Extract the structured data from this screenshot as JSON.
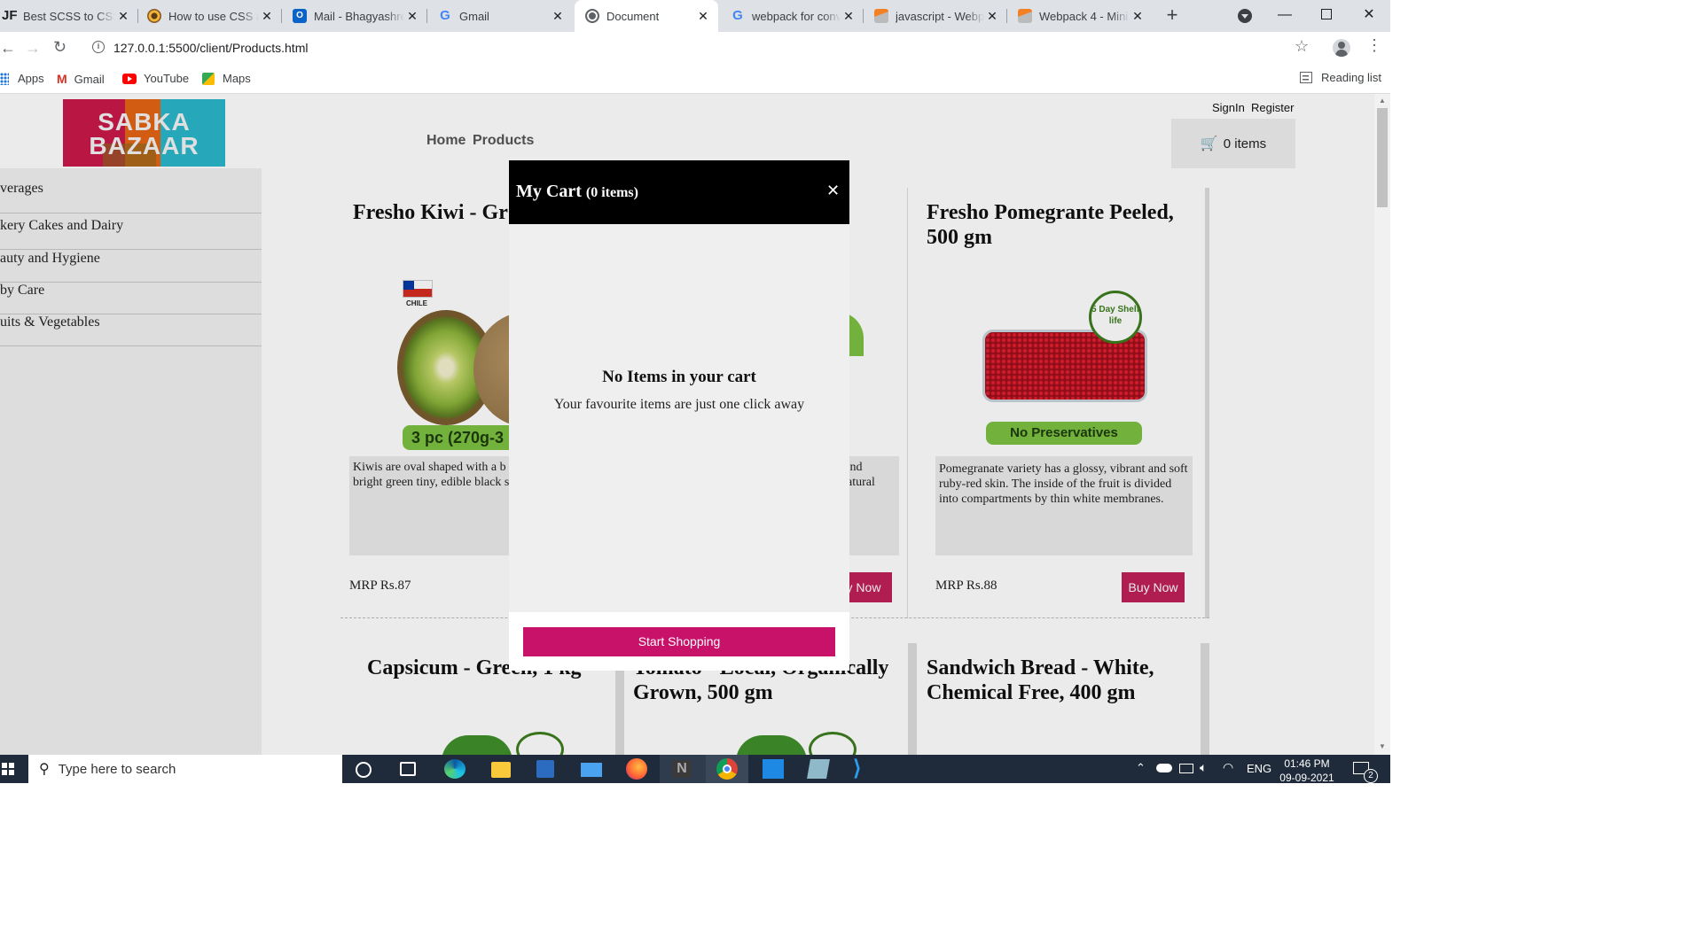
{
  "browser": {
    "tabs": [
      {
        "title": "Best SCSS to CSS",
        "favicon": "jf-icon",
        "active": false
      },
      {
        "title": "How to use CSS a",
        "favicon": "codegrepper-icon",
        "active": false
      },
      {
        "title": "Mail - Bhagyashre",
        "favicon": "outlook-icon",
        "active": false
      },
      {
        "title": "Gmail",
        "favicon": "google-icon",
        "active": false
      },
      {
        "title": "Document",
        "favicon": "globe-icon",
        "active": true
      },
      {
        "title": "webpack for conv",
        "favicon": "google-icon",
        "active": false
      },
      {
        "title": "javascript - Webp",
        "favicon": "stackoverflow-icon",
        "active": false
      },
      {
        "title": "Webpack 4 - Mini",
        "favicon": "stackoverflow-icon",
        "active": false
      }
    ],
    "new_tab_glyph": "+",
    "url": "127.0.0.1:5500/client/Products.html",
    "bookmarks": [
      {
        "label": "Apps",
        "icon": "apps-grid-icon"
      },
      {
        "label": "Gmail",
        "icon": "gmail-icon"
      },
      {
        "label": "YouTube",
        "icon": "youtube-icon"
      },
      {
        "label": "Maps",
        "icon": "maps-icon"
      }
    ],
    "reading_list": "Reading list"
  },
  "site": {
    "logo_line1": "SABKA",
    "logo_line2": "BAZAAR",
    "nav": [
      "Home",
      "Products"
    ],
    "auth": {
      "signin": "SignIn",
      "register": "Register"
    },
    "cart_button": "0 items",
    "categories": [
      "verages",
      "kery Cakes and Dairy",
      "auty and Hygiene",
      "by Care",
      "uits & Vegetables"
    ],
    "products": [
      {
        "title": "Fresho Kiwi - Gr",
        "image_badge": "3 pc (270g-3",
        "flag_label": "CHILE",
        "desc": "Kiwis are oval shaped with a b skin. The flesh is bright green tiny, edible black seeds.",
        "price": "MRP Rs.87"
      },
      {
        "title": "",
        "desc": "d nd natural",
        "buy": "y Now"
      },
      {
        "title": "Fresho Pomegrante Peeled, 500 gm",
        "image_badge": "No Preservatives",
        "shelf_life_badge": "5 Day Shelf life",
        "desc": "Pomegranate variety has a glossy, vibrant and soft ruby-red skin. The inside of the fruit is divided into compartments by thin white membranes.",
        "price": "MRP Rs.88",
        "buy": "Buy Now"
      },
      {
        "title": "Capsicum - Green, 1 kg"
      },
      {
        "title": "Tomato - Local, Organically Grown, 500 gm"
      },
      {
        "title": "Sandwich Bread - White, Chemical Free, 400 gm"
      }
    ]
  },
  "cart_modal": {
    "title": "My Cart",
    "count": "(0 items)",
    "close_glyph": "✕",
    "empty_heading": "No Items in your cart",
    "empty_sub": "Your favourite items are just one click away",
    "start_button": "Start Shopping"
  },
  "taskbar": {
    "search_placeholder": "Type here to search",
    "lang": "ENG",
    "time": "01:46 PM",
    "date": "09-09-2021",
    "notification_count": "2"
  },
  "colors": {
    "accent": "#bf2058",
    "modal_button": "#c8126a",
    "taskbar": "#1f2b3a"
  }
}
